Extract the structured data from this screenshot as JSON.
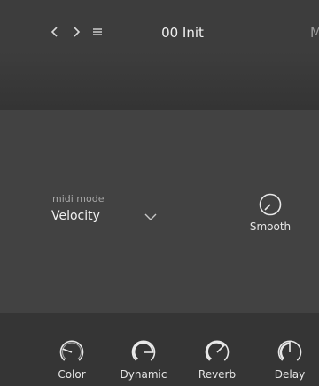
{
  "header": {
    "preset_name": "00 Init",
    "edge_text": "M",
    "icons": [
      "chevron-left-icon",
      "chevron-right-icon",
      "menu-icon"
    ]
  },
  "main": {
    "midi_mode_label": "midi mode",
    "midi_mode_value": "Velocity",
    "smooth_label": "Smooth"
  },
  "bottom": {
    "knobs": [
      {
        "label": "Color"
      },
      {
        "label": "Dynamic"
      },
      {
        "label": "Reverb"
      },
      {
        "label": "Delay"
      }
    ]
  },
  "colors": {
    "background": "#3a3a3a",
    "panel": "#424242",
    "footer": "#353535",
    "text": "#e6e6e6"
  }
}
